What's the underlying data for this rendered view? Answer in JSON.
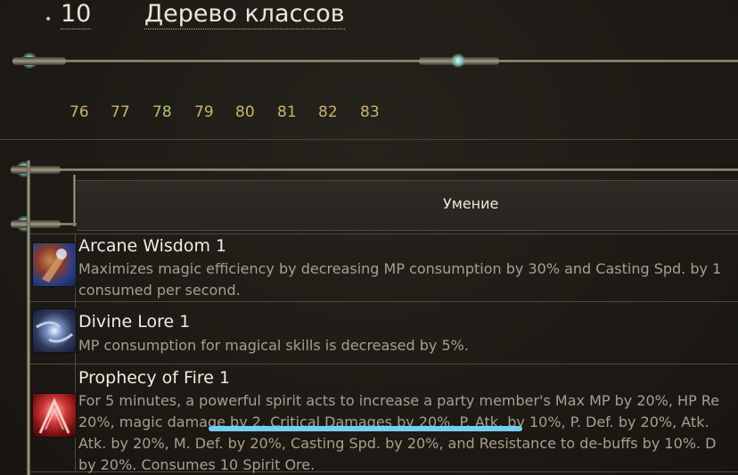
{
  "header": {
    "level": "10",
    "title": "Дерево классов"
  },
  "levels": [
    "76",
    "77",
    "78",
    "79",
    "80",
    "81",
    "82",
    "83"
  ],
  "active_level": "78",
  "table": {
    "column_header": "Умение",
    "rows": [
      {
        "name": "Arcane Wisdom 1",
        "icon": "arcane-wisdom-icon",
        "description_lines": [
          "Maximizes magic efficiency by decreasing MP consumption by 30% and Casting Spd. by 1",
          "consumed per second."
        ]
      },
      {
        "name": "Divine Lore 1",
        "icon": "divine-lore-icon",
        "description_lines": [
          "MP consumption for magical skills is decreased by 5%."
        ]
      },
      {
        "name": "Prophecy of Fire 1",
        "icon": "prophecy-of-fire-icon",
        "description_lines": [
          "For 5 minutes, a powerful spirit acts to increase a party member's Max MP by 20%, HP Re",
          "20%, magic damage by 2, Critical Damages by 20%, P. Atk. by 10%, P. Def. by 20%, Atk.",
          "Atk. by 20%, M. Def. by 20%, Casting Spd. by 20%, and Resistance to de-buffs by 10%. D",
          "by 20%. Consumes 10 Spirit Ore."
        ]
      }
    ]
  },
  "colors": {
    "background": "#1f1b16",
    "level_number": "#c8b56a",
    "active_level": "#a9c86f",
    "skill_name": "#f1ece0",
    "skill_desc": "#a79f8e",
    "swipe_indicator": "#6fd0f1"
  }
}
